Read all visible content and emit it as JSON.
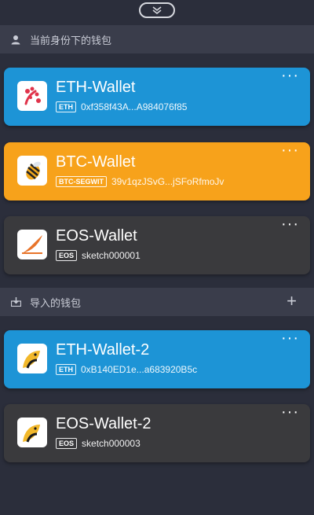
{
  "sections": {
    "current": {
      "title": "当前身份下的钱包"
    },
    "imported": {
      "title": "导入的钱包",
      "add_label": "+"
    }
  },
  "wallets": [
    {
      "name": "ETH-Wallet",
      "tag": "ETH",
      "address": "0xf358f43A...A984076f85",
      "color": "#1d94d6",
      "logo": "eth-red-logo"
    },
    {
      "name": "BTC-Wallet",
      "tag": "BTC-SEGWIT",
      "address": "39v1qzJSvG...jSFoRfmoJv",
      "color": "#f7a21b",
      "logo": "bee-logo"
    },
    {
      "name": "EOS-Wallet",
      "tag": "EOS",
      "address": "sketch000001",
      "color": "#3a3a3d",
      "logo": "orange-swoosh-logo"
    },
    {
      "name": "ETH-Wallet-2",
      "tag": "ETH",
      "address": "0xB140ED1e...a683920B5c",
      "color": "#1d94d6",
      "logo": "yellow-bird-logo"
    },
    {
      "name": "EOS-Wallet-2",
      "tag": "EOS",
      "address": "sketch000003",
      "color": "#3a3a3d",
      "logo": "yellow-bird-logo"
    }
  ],
  "more_label": "···"
}
